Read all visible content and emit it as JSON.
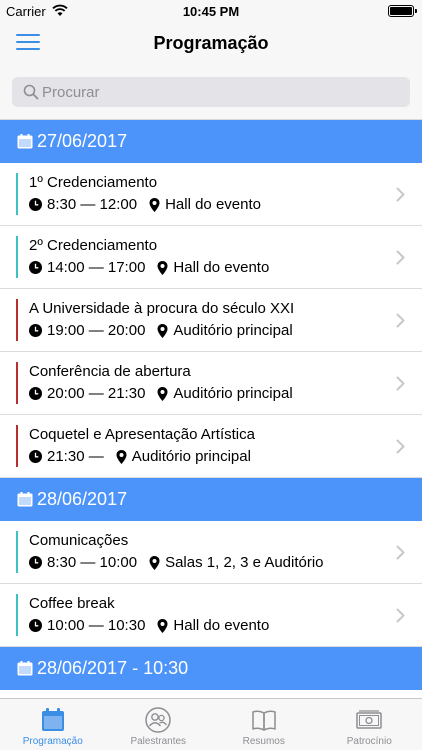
{
  "status_bar": {
    "carrier": "Carrier",
    "time": "10:45 PM"
  },
  "nav": {
    "title": "Programação"
  },
  "search": {
    "placeholder": "Procurar"
  },
  "colors": {
    "accent": "#4d94fa",
    "teal": "#3cc1c6",
    "red": "#b82f30"
  },
  "sections": [
    {
      "date": "27/06/2017",
      "items": [
        {
          "title": "1º Credenciamento",
          "time": "8:30 — 12:00",
          "location": "Hall do evento",
          "color": "#3cc1c6"
        },
        {
          "title": "2º Credenciamento",
          "time": "14:00 — 17:00",
          "location": "Hall do evento",
          "color": "#3cc1c6"
        },
        {
          "title": "A Universidade à procura do século XXI",
          "time": "19:00 — 20:00",
          "location": "Auditório principal",
          "color": "#b82f30"
        },
        {
          "title": "Conferência de abertura",
          "time": "20:00 — 21:30",
          "location": "Auditório principal",
          "color": "#b82f30"
        },
        {
          "title": "Coquetel e Apresentação Artística",
          "time": "21:30 —",
          "location": "Auditório principal",
          "color": "#b82f30"
        }
      ]
    },
    {
      "date": "28/06/2017",
      "items": [
        {
          "title": "Comunicações",
          "time": "8:30 — 10:00",
          "location": "Salas 1, 2, 3 e Auditório",
          "color": "#3cc1c6"
        },
        {
          "title": "Coffee break",
          "time": "10:00 — 10:30",
          "location": "Hall do evento",
          "color": "#3cc1c6"
        }
      ]
    },
    {
      "date": "28/06/2017 - 10:30",
      "items": []
    }
  ],
  "tabs": [
    {
      "label": "Programação",
      "icon": "calendar-icon",
      "active": true
    },
    {
      "label": "Palestrantes",
      "icon": "speakers-icon",
      "active": false
    },
    {
      "label": "Resumos",
      "icon": "book-icon",
      "active": false
    },
    {
      "label": "Patrocínio",
      "icon": "money-icon",
      "active": false
    }
  ]
}
